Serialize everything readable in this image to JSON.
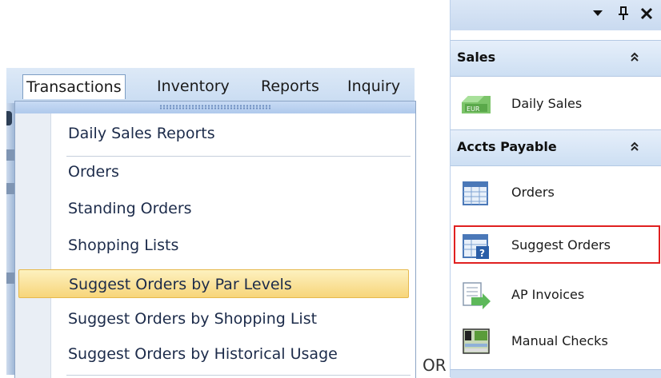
{
  "menubar": {
    "items": [
      "Transactions",
      "Inventory",
      "Reports",
      "Inquiry"
    ]
  },
  "dropdown": {
    "items": [
      "Daily Sales Reports",
      "Orders",
      "Standing Orders",
      "Shopping Lists",
      "Suggest Orders by Par Levels",
      "Suggest Orders by Shopping List",
      "Suggest Orders by Historical Usage"
    ],
    "highlighted": "Suggest Orders by Par Levels"
  },
  "connector": "OR",
  "panel": {
    "header_icons": [
      "dropdown-arrow-icon",
      "pin-icon",
      "close-icon"
    ],
    "sections": [
      {
        "title": "Sales",
        "items": [
          {
            "label": "Daily Sales",
            "icon": "daily-sales-icon"
          }
        ]
      },
      {
        "title": "Accts Payable",
        "items": [
          {
            "label": "Orders",
            "icon": "orders-grid-icon"
          },
          {
            "label": "Suggest Orders",
            "icon": "suggest-orders-icon",
            "selected": true
          },
          {
            "label": "AP Invoices",
            "icon": "ap-invoices-icon"
          },
          {
            "label": "Manual Checks",
            "icon": "manual-checks-icon"
          }
        ]
      }
    ]
  },
  "colors": {
    "highlight": "#f7d57a",
    "selection_border": "#e02020",
    "section_header": "#cddff3"
  }
}
